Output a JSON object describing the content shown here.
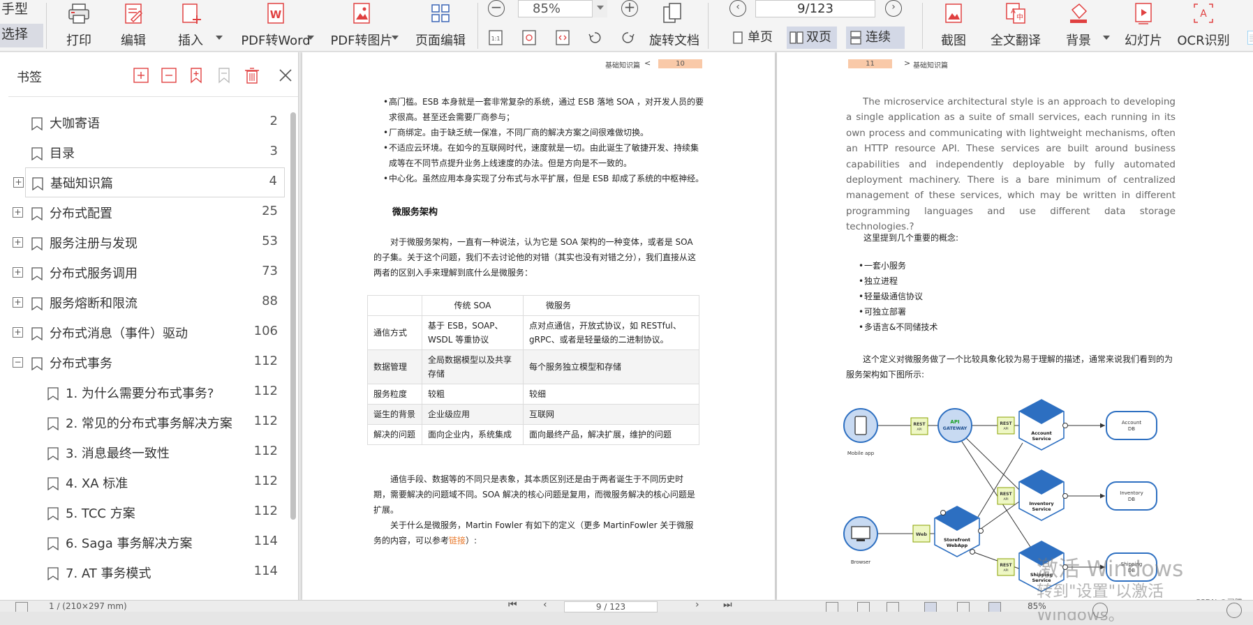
{
  "toolbar": {
    "left_tools": [
      "手型",
      "选择"
    ],
    "buttons": {
      "print": "打印",
      "edit": "编辑",
      "insert": "插入",
      "pdf2word": "PDF转Word",
      "pdf2img": "PDF转图片",
      "page_edit": "页面编辑",
      "rotate_doc": "旋转文档",
      "screenshot": "截图",
      "translate": "全文翻译",
      "background": "背景",
      "slideshow": "幻灯片",
      "ocr": "OCR识别"
    },
    "zoom": "85%",
    "page_indicator": "9/123",
    "view_modes": {
      "single": "单页",
      "double": "双页",
      "continuous": "连续"
    }
  },
  "sidebar": {
    "title": "书签",
    "bookmarks": [
      {
        "label": "大咖寄语",
        "page": "2",
        "expand": ""
      },
      {
        "label": "目录",
        "page": "3",
        "expand": ""
      },
      {
        "label": "基础知识篇",
        "page": "4",
        "expand": "+"
      },
      {
        "label": "分布式配置",
        "page": "25",
        "expand": "+"
      },
      {
        "label": "服务注册与发现",
        "page": "53",
        "expand": "+"
      },
      {
        "label": "分布式服务调用",
        "page": "73",
        "expand": "+"
      },
      {
        "label": "服务熔断和限流",
        "page": "88",
        "expand": "+"
      },
      {
        "label": "分布式消息（事件）驱动",
        "page": "106",
        "expand": "+"
      },
      {
        "label": "分布式事务",
        "page": "112",
        "expand": "−"
      },
      {
        "label": "1. 为什么需要分布式事务?",
        "page": "112",
        "expand": ""
      },
      {
        "label": "2. 常见的分布式事务解决方案",
        "page": "112",
        "expand": ""
      },
      {
        "label": "3. 消息最终一致性",
        "page": "112",
        "expand": ""
      },
      {
        "label": "4. XA 标准",
        "page": "112",
        "expand": ""
      },
      {
        "label": "5. TCC 方案",
        "page": "112",
        "expand": ""
      },
      {
        "label": "6. Saga 事务解决方案",
        "page": "114",
        "expand": ""
      },
      {
        "label": "7. AT 事务模式",
        "page": "114",
        "expand": ""
      }
    ]
  },
  "left_page": {
    "header_section": "基础知识篇",
    "header_arrow": "<",
    "page_number": "10",
    "bullets": [
      "高门槛。ESB 本身就是一套非常复杂的系统，通过 ESB 落地 SOA ，对开发人员的要求很高。甚至还会需要厂商参与；",
      "厂商绑定。由于缺乏统一保准，不同厂商的解决方案之间很难做切换。",
      "不适应云环境。在如今的互联网时代，速度就是一切。由此诞生了敏捷开发、持续集成等在不同节点提升业务上线速度的办法。但是方向是不一致的。",
      "中心化。虽然应用本身实现了分布式与水平扩展，但是 ESB 却成了系统的中枢神经。"
    ],
    "section_heading": "微服务架构",
    "para1": "对于微服务架构，一直有一种说法，认为它是 SOA 架构的一种变体，或者是 SOA 的子集。关于这个问题，我们不去讨论他的对错（其实也没有对错之分），我们直接从这两者的区别入手来理解到底什么是微服务：",
    "table": {
      "headers": [
        "",
        "传统 SOA",
        "微服务"
      ],
      "rows": [
        [
          "通信方式",
          "基于 ESB，SOAP、WSDL 等重协议",
          "点对点通信，开放式协议，如 RESTful、gRPC、或者是轻量级的二进制协议。"
        ],
        [
          "数据管理",
          "全局数据模型以及共享存储",
          "每个服务独立模型和存储"
        ],
        [
          "服务粒度",
          "较粗",
          "较细"
        ],
        [
          "诞生的背景",
          "企业级应用",
          "互联网"
        ],
        [
          "解决的问题",
          "面向企业内，系统集成",
          "面向最终产品，解决扩展，维护的问题"
        ]
      ]
    },
    "para2": "通信手段、数据等的不同只是表象，其本质区别还是由于两者诞生于不同历史时期，需要解决的问题域不同。SOA 解决的核心问题是复用，而微服务解决的核心问题是扩展。",
    "para3_pre": "关于什么是微服务，Martin Fowler 有如下的定义（更多 MartinFowler 关于微服务的内容，可以参考",
    "para3_link": "链接",
    "para3_post": "）:",
    "link_color": "#e8782a"
  },
  "right_page": {
    "page_number": "11",
    "header_arrow": ">",
    "header_section": "基础知识篇",
    "quote": "The microservice architectural style is an approach to developing a single application as a suite of small services, each running in its own process and communicating with lightweight mechanisms, often an HTTP resource API. These services are built around business capabilities and independently deployable by fully automated deployment machinery. There is a bare minimum of centralized management of these services, which may be written in different programming languages and use different data storage technologies.?",
    "concepts_intro": "这里提到几个重要的概念:",
    "concepts": [
      "一套小服务",
      "独立进程",
      "轻量级通信协议",
      "可独立部署",
      "多语言&不同储技术"
    ],
    "diagram_intro": "这个定义对微服务做了一个比较具象化较为易于理解的描述，通常来说我们看到的为服务架构如下图所示:",
    "diagram": {
      "mobile_app": "Mobile app",
      "browser": "Browser",
      "rest": "REST",
      "api": "API",
      "web": "Web",
      "api_gateway": [
        "API",
        "GATEWAY"
      ],
      "storefront": [
        "Storefront",
        "WebApp"
      ],
      "account_service": [
        "Account",
        "Service"
      ],
      "inventory_service": [
        "Inventory",
        "Service"
      ],
      "shipping_service": [
        "Shipping",
        "Service"
      ],
      "account_db": [
        "Account",
        "DB"
      ],
      "inventory_db": [
        "Inventory",
        "DB"
      ],
      "shipping_db": [
        "Shipping",
        "DB"
      ],
      "hex_color": "#2d6fc1",
      "rest_color": "#eef7c4"
    }
  },
  "watermark": {
    "line1": "激活 Windows",
    "line2": "转到\"设置\"以激活 Windows。"
  },
  "csdn": "CSDN @司腾",
  "statusbar": {
    "dims": "1 ∕ (210×297 mm)",
    "page": "9 ∕ 123",
    "zoom": "85%"
  }
}
